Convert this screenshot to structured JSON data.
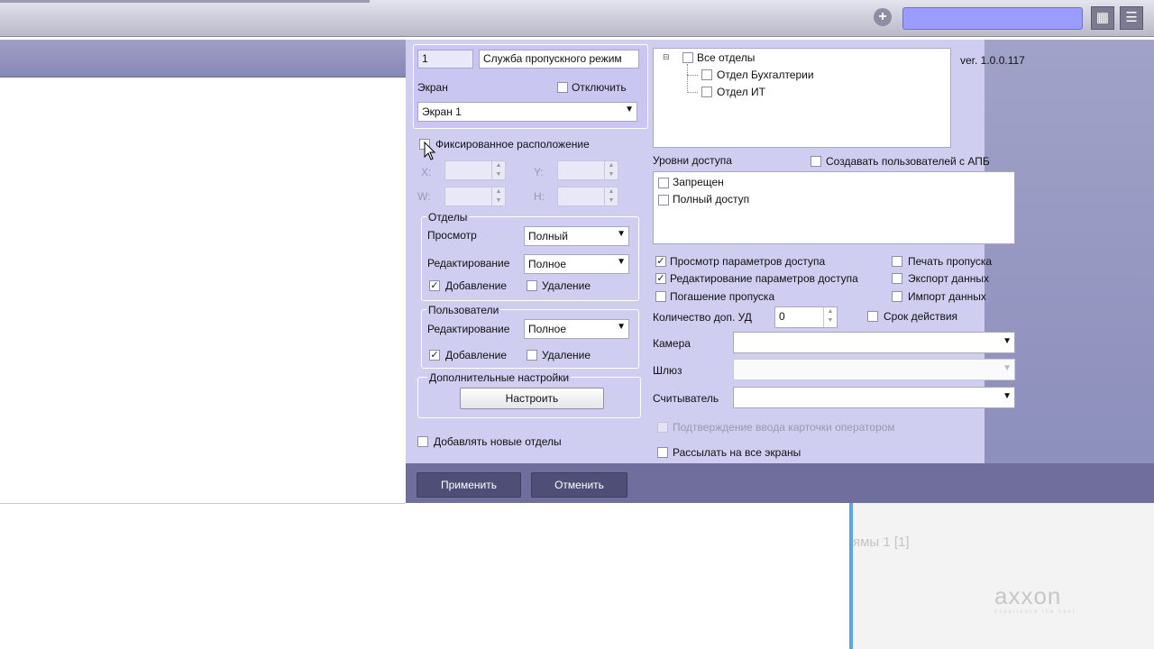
{
  "dialog": {
    "id_value": "1",
    "service_name": "Служба пропускного режим",
    "screen_label": "Экран",
    "disable_label": "Отключить",
    "screen_select": "Экран 1",
    "fixed_label": "Фиксированное расположение",
    "x_label": "X:",
    "y_label": "Y:",
    "w_label": "W:",
    "h_label": "H:",
    "departments_group": "Отделы",
    "dept_view_label": "Просмотр",
    "dept_view_value": "Полный",
    "dept_edit_label": "Редактирование",
    "dept_edit_value": "Полное",
    "dept_add_label": "Добавление",
    "dept_delete_label": "Удаление",
    "users_group": "Пользователи",
    "users_edit_label": "Редактирование",
    "users_edit_value": "Полное",
    "users_add_label": "Добавление",
    "users_delete_label": "Удаление",
    "extra_group": "Дополнительные настройки",
    "configure_button": "Настроить",
    "add_new_depts_label": "Добавлять новые отделы",
    "tree_root": "Все отделы",
    "tree_child_1": "Отдел Бухгалтерии",
    "tree_child_2": "Отдел ИТ",
    "version": "ver. 1.0.0.117",
    "access_levels_label": "Уровни доступа",
    "create_apb_label": "Создавать пользователей с АПБ",
    "access_item_1": "Запрещен",
    "access_item_2": "Полный доступ",
    "perm_view_access": "Просмотр параметров доступа",
    "perm_edit_access": "Редактирование параметров доступа",
    "perm_revoke": "Погашение пропуска",
    "perm_print": "Печать пропуска",
    "perm_export": "Экспорт данных",
    "perm_import": "Импорт данных",
    "extra_ud_label": "Количество доп. УД",
    "extra_ud_value": "0",
    "expiry_label": "Срок действия",
    "camera_label": "Камера",
    "gateway_label": "Шлюз",
    "reader_label": "Считыватель",
    "operator_confirm_label": "Подтверждение ввода карточки оператором",
    "broadcast_label": "Рассылать на все экраны",
    "apply_button": "Применить",
    "cancel_button": "Отменить"
  },
  "background": {
    "camera_title": "ямы 1 [1]",
    "brand": "axxon",
    "brand_tagline": "experience the next"
  },
  "checked": {
    "dept_add": true,
    "users_add": true,
    "perm_view_access": true,
    "perm_edit_access": true
  }
}
